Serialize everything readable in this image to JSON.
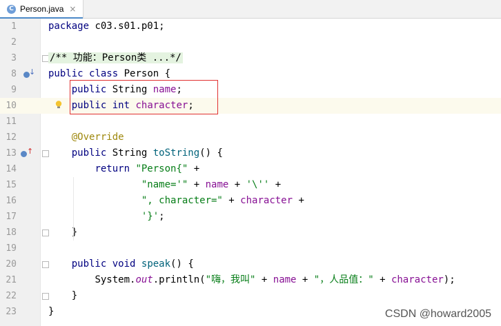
{
  "tab": {
    "title": "Person.java",
    "icon_letter": "C",
    "close": "×"
  },
  "lines": [
    {
      "n": "1"
    },
    {
      "n": "2"
    },
    {
      "n": "3"
    },
    {
      "n": "8"
    },
    {
      "n": "9"
    },
    {
      "n": "10"
    },
    {
      "n": "11"
    },
    {
      "n": "12"
    },
    {
      "n": "13"
    },
    {
      "n": "14"
    },
    {
      "n": "15"
    },
    {
      "n": "16"
    },
    {
      "n": "17"
    },
    {
      "n": "18"
    },
    {
      "n": "19"
    },
    {
      "n": "20"
    },
    {
      "n": "21"
    },
    {
      "n": "22"
    },
    {
      "n": "23"
    }
  ],
  "code": {
    "l1_pkg": "package",
    "l1_rest": " c03.s01.p01;",
    "l3_fold": "/** 功能：Person类 ...*/",
    "l8_public": "public",
    "l8_class": "class",
    "l8_rest": " Person {",
    "l9_public": "public",
    "l9_type": " String ",
    "l9_field": "name",
    "l9_semi": ";",
    "l10_public": "public",
    "l10_int": "int",
    "l10_field": "character",
    "l10_semi": ";",
    "l12_ann": "@Override",
    "l13_public": "public",
    "l13_type": " String ",
    "l13_fn": "toString",
    "l13_rest": "() {",
    "l14_return": "return",
    "l14_str": "\"Person{\"",
    "l14_plus": " +",
    "l15_str": "\"name='\"",
    "l15_p1": " + ",
    "l15_field": "name",
    "l15_p2": " + ",
    "l15_str2": "'\\''",
    "l15_p3": " +",
    "l16_str": "\", character=\"",
    "l16_p1": " + ",
    "l16_field": "character",
    "l16_p2": " +",
    "l17_str": "'}'",
    "l17_semi": ";",
    "l18_close": "}",
    "l20_public": "public",
    "l20_void": "void",
    "l20_fn": "speak",
    "l20_rest": "() {",
    "l21_sys": "System.",
    "l21_out": "out",
    "l21_print": ".println(",
    "l21_str1": "\"嗨，我叫\"",
    "l21_p1": " + ",
    "l21_field1": "name",
    "l21_p2": " + ",
    "l21_str2": "\"，人品值：\"",
    "l21_p3": " + ",
    "l21_field2": "character",
    "l21_end": ");",
    "l22_close": "}",
    "l23_close": "}"
  },
  "watermark": "CSDN @howard2005",
  "colors": {
    "keyword": "#000080",
    "string": "#067d17",
    "field": "#871094",
    "annotation": "#9e880d",
    "method": "#00627a",
    "highlight_box": "#e03030"
  }
}
